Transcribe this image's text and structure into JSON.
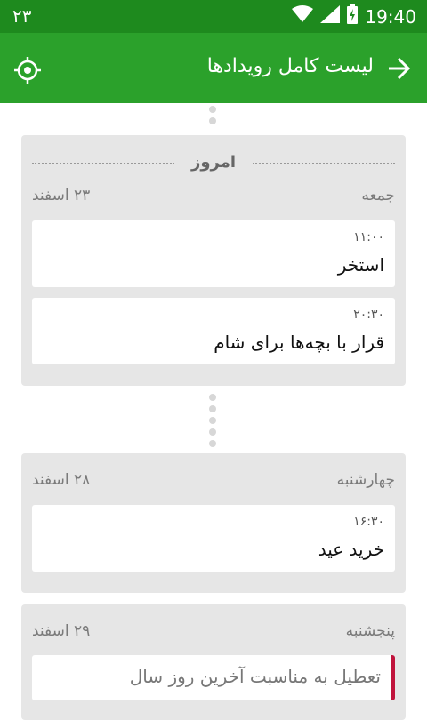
{
  "status_bar": {
    "left_text": "۲۳",
    "time": "19:40"
  },
  "app_bar": {
    "title": "لیست کامل رویدادها"
  },
  "days": [
    {
      "today_label": "امروز",
      "day_name": "جمعه",
      "date": "۲۳ اسفند",
      "events": [
        {
          "time": "۱۱:۰۰",
          "title": "استخر"
        },
        {
          "time": "۲۰:۳۰",
          "title": "قرار با بچه‌ها برای شام"
        }
      ]
    },
    {
      "day_name": "چهارشنبه",
      "date": "۲۸ اسفند",
      "events": [
        {
          "time": "۱۶:۳۰",
          "title": "خرید عید"
        }
      ]
    },
    {
      "day_name": "پنجشنبه",
      "date": "۲۹ اسفند",
      "events": [
        {
          "title": "تعطیل به مناسبت آخرین روز سال",
          "holiday": true
        }
      ]
    }
  ],
  "colors": {
    "status_bar": "#1e8a1e",
    "app_bar": "#2ba12b",
    "card": "#e6e6e6",
    "holiday_accent": "#c0143c"
  }
}
